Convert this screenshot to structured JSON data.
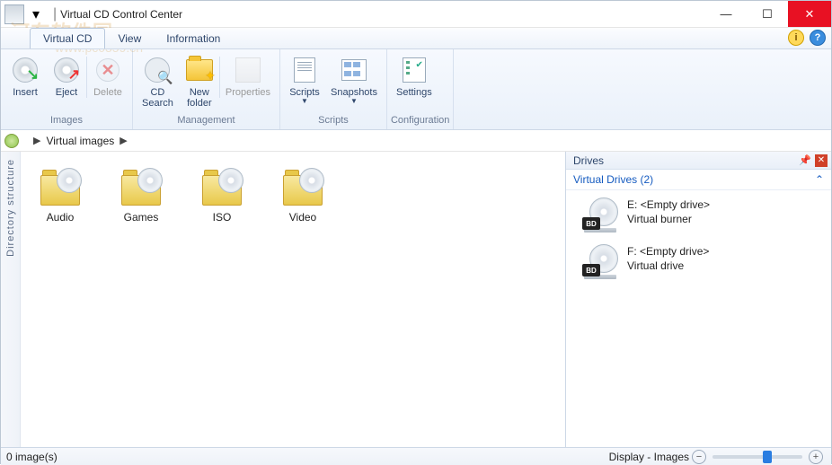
{
  "window": {
    "title": "Virtual CD Control Center",
    "qat_separator": "|"
  },
  "tabs": {
    "virtual_cd": "Virtual CD",
    "view": "View",
    "information": "Information"
  },
  "ribbon": {
    "images": {
      "label": "Images",
      "insert": "Insert",
      "eject": "Eject",
      "delete": "Delete"
    },
    "management": {
      "label": "Management",
      "cd_search_l1": "CD",
      "cd_search_l2": "Search",
      "new_folder_l1": "New",
      "new_folder_l2": "folder",
      "properties": "Properties"
    },
    "scripts": {
      "label": "Scripts",
      "scripts": "Scripts",
      "snapshots": "Snapshots"
    },
    "configuration": {
      "label": "Configuration",
      "settings": "Settings"
    }
  },
  "breadcrumb": {
    "item": "Virtual images"
  },
  "sidetab": {
    "label": "Directory structure"
  },
  "folders": [
    {
      "label": "Audio"
    },
    {
      "label": "Games"
    },
    {
      "label": "ISO"
    },
    {
      "label": "Video"
    }
  ],
  "drives_panel": {
    "title": "Drives",
    "section": "Virtual Drives (2)",
    "items": [
      {
        "letter": "E:",
        "state": "<Empty drive>",
        "type": "Virtual burner",
        "badge": "BD"
      },
      {
        "letter": "F:",
        "state": "<Empty drive>",
        "type": "Virtual drive",
        "badge": "BD"
      }
    ]
  },
  "status": {
    "left": "0 image(s)",
    "display": "Display - Images"
  },
  "watermark": {
    "line1": "河东软件园",
    "line2": "www.pc0359.cn"
  }
}
